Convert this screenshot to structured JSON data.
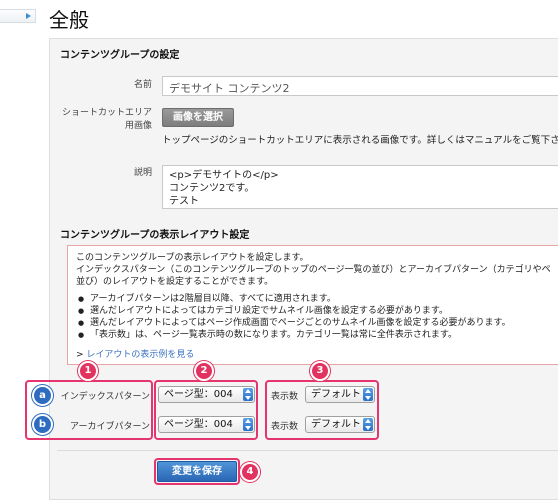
{
  "page": {
    "title": "全般"
  },
  "content_group": {
    "section_title": "コンテンツグループの設定",
    "name": {
      "label": "名前",
      "value": "デモサイト コンテンツ2"
    },
    "shortcut": {
      "label_line1": "ショートカットエリア",
      "label_line2": "用画像",
      "button_label": "画像を選択",
      "help_text": "トップページのショートカットエリアに表示される画像です。詳しくはマニュアルをご覧下さい。"
    },
    "description": {
      "label": "説明",
      "lines": [
        "<p>デモサイトの</p>",
        "コンテンツ2です。",
        "テスト"
      ]
    }
  },
  "layout": {
    "section_title": "コンテンツグループの表示レイアウト設定",
    "info": {
      "line1": "このコンテンツグループの表示レイアウトを設定します。",
      "line2": "インデックスパターン（このコンテンツグループのトップのページ一覧の並び）とアーカイブパターン（カテゴリやペ",
      "line3": "並び）のレイアウトを設定することができます。",
      "bullets": [
        "アーカイブパターンは2階層目以降、すべてに適用されます。",
        "選んだレイアウトによってはカテゴリ設定でサムネイル画像を設定する必要があります。",
        "選んだレイアウトによってはページ作成画面でページごとのサムネイル画像を設定する必要があります。",
        "「表示数」は、ページ一覧表示時の数になります。カテゴリ一覧は常に全件表示されます。"
      ],
      "link_prefix": ">",
      "link_text": "レイアウトの表示例を見る"
    },
    "rows": [
      {
        "badge": "a",
        "label": "インデックスパターン",
        "pattern": "ページ型：004",
        "count_label": "表示数",
        "count": "デフォルト"
      },
      {
        "badge": "b",
        "label": "アーカイブパターン",
        "pattern": "ページ型：004",
        "count_label": "表示数",
        "count": "デフォルト"
      }
    ],
    "number_badges": [
      "1",
      "2",
      "3",
      "4"
    ]
  },
  "actions": {
    "save_label": "変更を保存"
  },
  "colors": {
    "highlight": "#e5356f",
    "badge_number": "#e2325f",
    "badge_letter": "#2e6cc0",
    "primary_button": "#2a66b5",
    "link": "#3970c0"
  }
}
